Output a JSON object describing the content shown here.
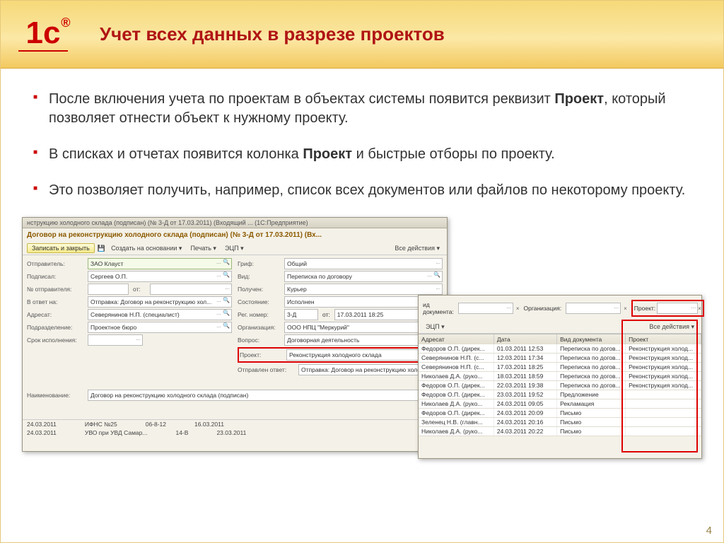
{
  "slide": {
    "title": "Учет всех данных в разрезе проектов",
    "page_number": "4",
    "logo_text": "1с"
  },
  "bullets": {
    "b1_a": "После включения учета по проектам в объектах системы появится реквизит ",
    "b1_bold": "Проект",
    "b1_b": ", который позволяет отнести объект к нужному проекту.",
    "b2_a": "В списках и отчетах появится колонка ",
    "b2_bold": "Проект",
    "b2_b": " и быстрые отборы по проекту.",
    "b3": "Это позволяет получить, например, список всех документов или файлов по некоторому проекту."
  },
  "win1": {
    "winbar": "нструкцию холодного склада (подписан) (№ 3-Д от 17.03.2011) (Входящий ... (1С:Предприятие)",
    "doc_title": "Договор на реконструкцию холодного склада (подписан) (№ 3-Д от 17.03.2011) (Вх...",
    "save": "Записать и закрыть",
    "tb_create": "Создать на основании ▾",
    "tb_print": "Печать ▾",
    "tb_ecp": "ЭЦП ▾",
    "tb_all": "Все действия ▾",
    "labels": {
      "otprav": "Отправитель:",
      "podpisal": "Подписал:",
      "no_otprav": "№ отправителя:",
      "ot": "от:",
      "v_otvet": "В ответ на:",
      "adresat": "Адресат:",
      "podrazd": "Подразделение:",
      "srok": "Срок исполнения:",
      "grif": "Гриф:",
      "vid": "Вид:",
      "poluchen": "Получен:",
      "sost": "Состояние:",
      "regno": "Рег. номер:",
      "ot2": "от:",
      "org": "Организация:",
      "vopros": "Вопрос:",
      "proekt": "Проект:",
      "otprav_otvet": "Отправлен ответ:",
      "naimen": "Наименование:"
    },
    "values": {
      "otprav": "ЗАО Клауст",
      "podpisal": "Сергеев О.П.",
      "v_otvet": "Отправка: Договор на реконструкцию хол...",
      "adresat": "Северянинов Н.П. (специалист)",
      "podrazd": "Проектное бюро",
      "grif": "Общий",
      "vid": "Переписка по договору",
      "poluchen": "Курьер",
      "sost": "Исполнен",
      "regno": "3-Д",
      "regdate": "17.03.2011 18:25",
      "org": "ООО НПЦ \"Меркурий\"",
      "vopros": "Договорная деятельность",
      "proekt": "Реконструкция холодного склада",
      "otprav_otvet": "Отправка: Договор на реконструкцию холодног",
      "naimen": "Договор на реконструкцию холодного склада (подписан)"
    },
    "bottom": [
      {
        "date": "24.03.2011",
        "org": "ИФНС №25",
        "num": "06-8-12",
        "d2": "16.03.2011"
      },
      {
        "date": "24.03.2011",
        "org": "УВО при УВД Самар...",
        "num": "14-В",
        "d2": "23.03.2011"
      }
    ]
  },
  "win2": {
    "filter": {
      "vid": "ид документа:",
      "org": "Организация:",
      "proj": "Проект:"
    },
    "tb_ecp": "ЭЦП ▾",
    "tb_all": "Все действия ▾",
    "headers": {
      "adresat": "Адресат",
      "date": "Дата",
      "vid": "Вид документа",
      "proj": "Проект"
    },
    "rows": [
      {
        "a": "Федоров О.П. (дирек...",
        "d": "01.03.2011 12:53",
        "v": "Переписка по догов...",
        "p": "Реконструкция холод..."
      },
      {
        "a": "Северянинов Н.П. (с...",
        "d": "12.03.2011 17:34",
        "v": "Переписка по догов...",
        "p": "Реконструкция холод..."
      },
      {
        "a": "Северянинов Н.П. (с...",
        "d": "17.03.2011 18:25",
        "v": "Переписка по догов...",
        "p": "Реконструкция холод..."
      },
      {
        "a": "Николаев Д.А. (руко...",
        "d": "18.03.2011 18:59",
        "v": "Переписка по догов...",
        "p": "Реконструкция холод..."
      },
      {
        "a": "Федоров О.П. (дирек...",
        "d": "22.03.2011 19:38",
        "v": "Переписка по догов...",
        "p": "Реконструкция холод..."
      },
      {
        "a": "Федоров О.П. (дирек...",
        "d": "23.03.2011 19:52",
        "v": "Предложение",
        "p": ""
      },
      {
        "a": "Николаев Д.А. (руко...",
        "d": "24.03.2011 09:05",
        "v": "Рекламация",
        "p": ""
      },
      {
        "a": "Федоров О.П. (дирек...",
        "d": "24.03.2011 20:09",
        "v": "Письмо",
        "p": ""
      },
      {
        "a": "Зеленец Н.В. (главн...",
        "d": "24.03.2011 20:16",
        "v": "Письмо",
        "p": ""
      },
      {
        "a": "Николаев Д.А. (руко...",
        "d": "24.03.2011 20:22",
        "v": "Письмо",
        "p": ""
      }
    ]
  }
}
